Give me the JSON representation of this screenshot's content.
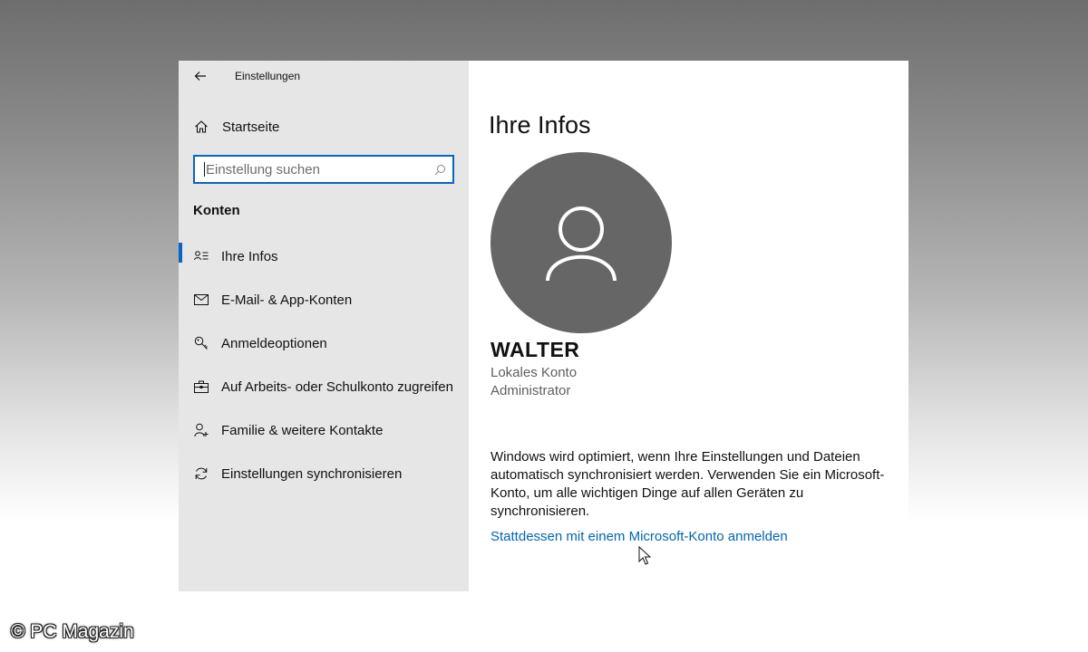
{
  "window": {
    "app_title": "Einstellungen",
    "back_icon": "back-arrow-icon"
  },
  "sidebar": {
    "home": {
      "label": "Startseite",
      "icon": "home-icon"
    },
    "search": {
      "placeholder": "Einstellung suchen",
      "value": "",
      "icon": "search-icon"
    },
    "section_title": "Konten",
    "items": [
      {
        "label": "Ihre Infos",
        "icon": "contact-info-icon",
        "active": true
      },
      {
        "label": "E-Mail- & App-Konten",
        "icon": "mail-icon",
        "active": false
      },
      {
        "label": "Anmeldeoptionen",
        "icon": "key-icon",
        "active": false
      },
      {
        "label": "Auf Arbeits- oder Schulkonto zugreifen",
        "icon": "briefcase-icon",
        "active": false
      },
      {
        "label": "Familie & weitere Kontakte",
        "icon": "add-person-icon",
        "active": false
      },
      {
        "label": "Einstellungen synchronisieren",
        "icon": "sync-icon",
        "active": false
      }
    ]
  },
  "main": {
    "title": "Ihre Infos",
    "avatar_icon": "user-avatar-icon",
    "user_name": "WALTER",
    "account_type": "Lokales Konto",
    "account_role": "Administrator",
    "info_text": "Windows wird optimiert, wenn Ihre Einstellungen und Dateien automatisch synchronisiert werden. Verwenden Sie ein Microsoft-Konto, um alle wichtigen Dinge auf allen Geräten zu synchronisieren.",
    "link_label": "Stattdessen mit einem Microsoft-Konto anmelden"
  },
  "watermark": "© PC Magazin",
  "colors": {
    "accent": "#0a64c2",
    "link": "#0066b4",
    "sidebar_bg": "#e6e6e6",
    "avatar_bg": "#666666"
  }
}
